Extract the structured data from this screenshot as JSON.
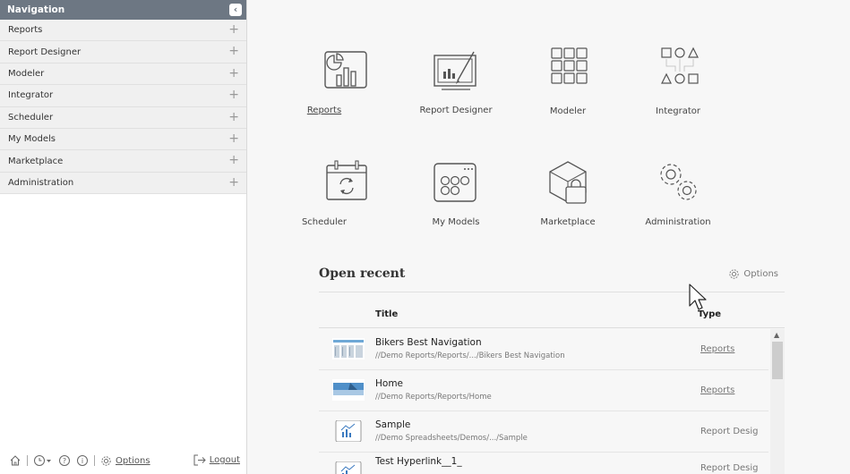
{
  "sidebar": {
    "header": "Navigation",
    "items": [
      {
        "label": "Reports"
      },
      {
        "label": "Report Designer"
      },
      {
        "label": "Modeler"
      },
      {
        "label": "Integrator"
      },
      {
        "label": "Scheduler"
      },
      {
        "label": "My Models"
      },
      {
        "label": "Marketplace"
      },
      {
        "label": "Administration"
      }
    ],
    "footer": {
      "options_label": "Options",
      "logout_label": "Logout"
    }
  },
  "tiles": [
    {
      "label": "Reports",
      "icon": "reports-icon"
    },
    {
      "label": "Report Designer",
      "icon": "report-designer-icon"
    },
    {
      "label": "Modeler",
      "icon": "modeler-icon"
    },
    {
      "label": "Integrator",
      "icon": "integrator-icon"
    },
    {
      "label": "Scheduler",
      "icon": "scheduler-icon"
    },
    {
      "label": "My Models",
      "icon": "my-models-icon"
    },
    {
      "label": "Marketplace",
      "icon": "marketplace-icon"
    },
    {
      "label": "Administration",
      "icon": "administration-icon"
    }
  ],
  "recent": {
    "title": "Open recent",
    "options_label": "Options",
    "columns": {
      "title": "Title",
      "type": "Type"
    },
    "rows": [
      {
        "title": "Bikers Best Navigation",
        "path": "//Demo Reports/Reports/.../Bikers Best Navigation",
        "type": "Reports"
      },
      {
        "title": "Home",
        "path": "//Demo Reports/Reports/Home",
        "type": "Reports"
      },
      {
        "title": "Sample",
        "path": "//Demo Spreadsheets/Demos/.../Sample",
        "type": "Report Desig"
      },
      {
        "title": "Test Hyperlink__1_",
        "path": "",
        "type": "Report Desig"
      }
    ]
  },
  "colors": {
    "nav_header_bg": "#6d7783",
    "sidebar_item_bg": "#f0f0f0",
    "main_bg": "#f7f7f7"
  }
}
